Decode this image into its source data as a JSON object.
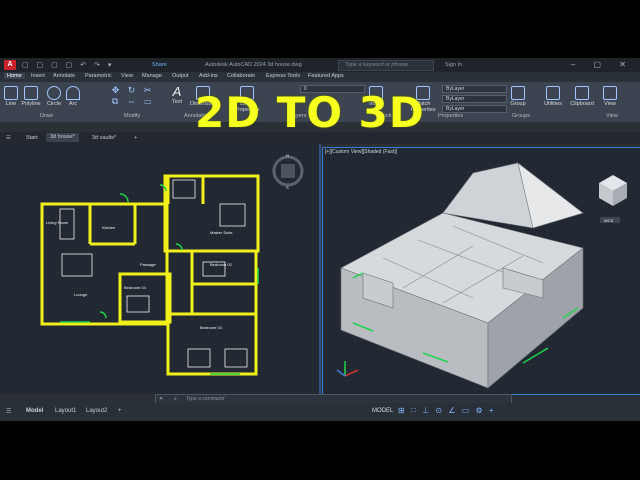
{
  "overlay_text": "2D TO 3D",
  "titlebar": {
    "app_logo": "A",
    "qat": "▢ ▢ ▢ ▢ ↶ ↷ ▾",
    "share": "Share",
    "title": "Autodesk AutoCAD 2024   3d house.dwg",
    "search_placeholder": "Type a keyword or phrase",
    "signin": "Sign In",
    "window_controls": "– ▢ ✕"
  },
  "menu_tabs": [
    "Home",
    "Insert",
    "Annotate",
    "Parametric",
    "View",
    "Manage",
    "Output",
    "Add-ins",
    "Collaborate",
    "Express Tools",
    "Featured Apps"
  ],
  "ribbon": {
    "tools": [
      "Line",
      "Polyline",
      "Circle",
      "Arc",
      "Text",
      "Dimension",
      "Layer Properties",
      "Insert",
      "Match Properties",
      "Group",
      "Utilities",
      "Clipboard",
      "View"
    ],
    "panels": [
      "Draw",
      "Modify",
      "Annotation",
      "Layers",
      "Block",
      "Properties",
      "Groups",
      "View"
    ],
    "layer_value": "0",
    "bylayer": [
      "ByLayer",
      "ByLayer",
      "ByLayer"
    ]
  },
  "doc_tabs": [
    "Start",
    "3d house*",
    "3d vaults*"
  ],
  "viewport_caption": "[+][Custom View][Shaded (Fast)]",
  "viewcube_label": "WCS",
  "compass_letters": [
    "N",
    "S",
    "E",
    "W"
  ],
  "rooms": [
    "Living Room",
    "Kitchen",
    "Master Suite",
    "Bedroom 02",
    "Passage",
    "Bedroom 04",
    "Lounge",
    "Bedroom 03"
  ],
  "command_placeholder": "Type a command",
  "layout_tabs": [
    "Model",
    "Layout1",
    "Layout2"
  ],
  "status": {
    "model_label": "MODEL",
    "icons": "⊞ ∷ ⊥ ⊙ ∠ ▭ ⚙ +"
  }
}
